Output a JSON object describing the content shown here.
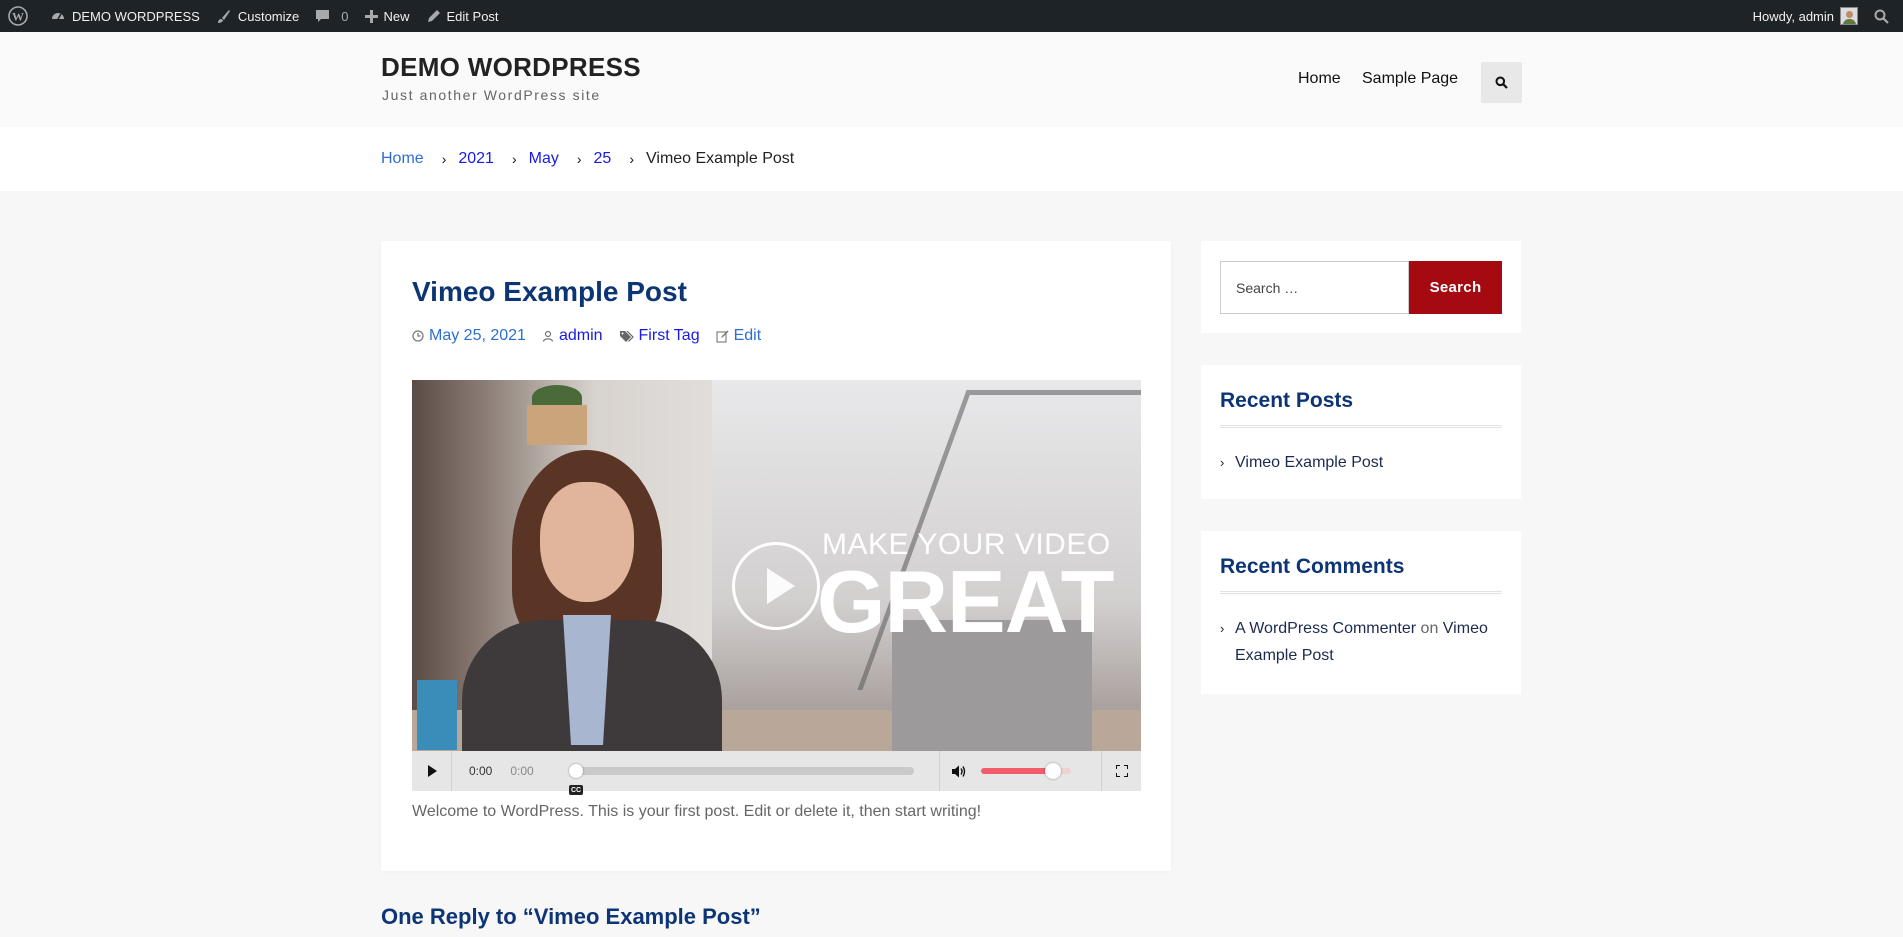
{
  "adminbar": {
    "site_name": "DEMO WORDPRESS",
    "customize": "Customize",
    "comments_count": "0",
    "new": "New",
    "edit_post": "Edit Post",
    "howdy": "Howdy, admin"
  },
  "header": {
    "site_title": "DEMO WORDPRESS",
    "tagline": "Just another WordPress site",
    "nav": [
      "Home",
      "Sample Page"
    ]
  },
  "breadcrumb": {
    "items": [
      "Home",
      "2021",
      "May",
      "25"
    ],
    "current": "Vimeo Example Post"
  },
  "post": {
    "title": "Vimeo Example Post",
    "date": "May 25, 2021",
    "author": "admin",
    "tag": "First Tag",
    "edit": "Edit",
    "video": {
      "overlay_line1": "MAKE YOUR VIDEO",
      "overlay_line2": "GREAT",
      "current_time": "0:00",
      "duration": "0:00",
      "captions": "CC",
      "progress": 0,
      "volume": 0.8
    },
    "body": "Welcome to WordPress. This is your first post. Edit or delete it, then start writing!"
  },
  "comments": {
    "heading": "One Reply to “Vimeo Example Post”"
  },
  "sidebar": {
    "search": {
      "placeholder": "Search …",
      "button": "Search"
    },
    "recent_posts": {
      "title": "Recent Posts",
      "items": [
        "Vimeo Example Post"
      ]
    },
    "recent_comments": {
      "title": "Recent Comments",
      "author": "A WordPress Commenter",
      "on": "on",
      "post": "Vimeo Example Post"
    }
  },
  "colors": {
    "admin_bar": "#1d2327",
    "title_blue": "#0d3576",
    "search_button": "#a50a10",
    "volume_fill": "#f35c6b"
  }
}
